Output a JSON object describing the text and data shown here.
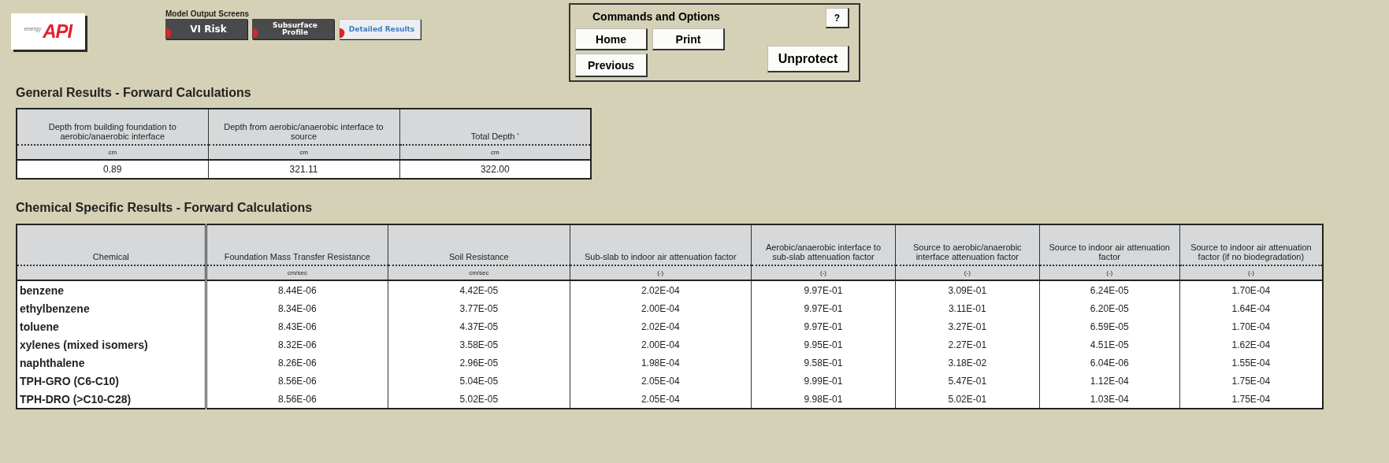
{
  "logo": {
    "tagline": "energy",
    "name": "API"
  },
  "nav": {
    "title": "Model Output Screens",
    "tabs": [
      {
        "label": "VI Risk",
        "selected": false
      },
      {
        "label": "Subsurface Profile",
        "selected": false
      },
      {
        "label": "Detailed Results",
        "selected": true
      }
    ]
  },
  "commands": {
    "title": "Commands and Options",
    "help": "?",
    "buttons": [
      {
        "label": "Home",
        "kind": "home"
      },
      {
        "label": "Print",
        "kind": "print"
      },
      {
        "label": "Previous",
        "kind": "previous"
      },
      {
        "label": "Unprotect",
        "kind": "unprotect"
      }
    ]
  },
  "general": {
    "title": "General Results - Forward Calculations",
    "columns": [
      {
        "label": "Depth from building foundation to aerobic/anaerobic interface",
        "unit": "cm"
      },
      {
        "label": "Depth from aerobic/anaerobic interface to source",
        "unit": "cm"
      },
      {
        "label": "Total Depth '",
        "unit": "cm"
      }
    ],
    "values": [
      "0.89",
      "321.11",
      "322.00"
    ]
  },
  "chemical": {
    "title": "Chemical Specific Results - Forward Calculations",
    "columns": [
      {
        "label": "Chemical"
      },
      {
        "label": "Foundation Mass Transfer Resistance",
        "unit": "cm/sec"
      },
      {
        "label": "Soil Resistance",
        "unit": "cm/sec"
      },
      {
        "label": "Sub-slab to indoor air attenuation factor",
        "unit": "(-)"
      },
      {
        "label": "Aerobic/anaerobic interface  to sub-slab attenuation factor",
        "unit": "(-)"
      },
      {
        "label": "Source to aerobic/anaerobic interface attenuation factor",
        "unit": "(-)"
      },
      {
        "label": "Source to indoor air attenuation factor",
        "unit": "(-)"
      },
      {
        "label": "Source to indoor air attenuation factor (if no biodegradation)",
        "unit": "(-)"
      }
    ],
    "rows": [
      [
        "benzene",
        "8.44E-06",
        "4.42E-05",
        "2.02E-04",
        "9.97E-01",
        "3.09E-01",
        "6.24E-05",
        "1.70E-04"
      ],
      [
        "ethylbenzene",
        "8.34E-06",
        "3.77E-05",
        "2.00E-04",
        "9.97E-01",
        "3.11E-01",
        "6.20E-05",
        "1.64E-04"
      ],
      [
        "toluene",
        "8.43E-06",
        "4.37E-05",
        "2.02E-04",
        "9.97E-01",
        "3.27E-01",
        "6.59E-05",
        "1.70E-04"
      ],
      [
        "xylenes (mixed isomers)",
        "8.32E-06",
        "3.58E-05",
        "2.00E-04",
        "9.95E-01",
        "2.27E-01",
        "4.51E-05",
        "1.62E-04"
      ],
      [
        "naphthalene",
        "8.26E-06",
        "2.96E-05",
        "1.98E-04",
        "9.58E-01",
        "3.18E-02",
        "6.04E-06",
        "1.55E-04"
      ],
      [
        "TPH-GRO (C6-C10)",
        "8.56E-06",
        "5.04E-05",
        "2.05E-04",
        "9.99E-01",
        "5.47E-01",
        "1.12E-04",
        "1.75E-04"
      ],
      [
        "TPH-DRO (>C10-C28)",
        "8.56E-06",
        "5.02E-05",
        "2.05E-04",
        "9.98E-01",
        "5.02E-01",
        "1.03E-04",
        "1.75E-04"
      ]
    ]
  }
}
